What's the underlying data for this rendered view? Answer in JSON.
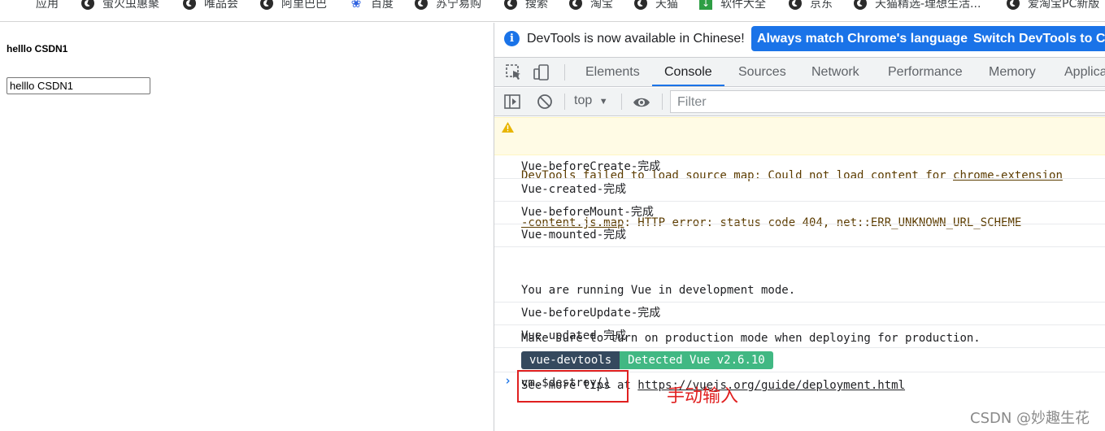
{
  "bookmarks": [
    {
      "label": "应用",
      "icon": "apps-icon"
    },
    {
      "label": "萤火虫惠聚",
      "icon": "globe-icon"
    },
    {
      "label": "唯品会",
      "icon": "globe-icon"
    },
    {
      "label": "阿里巴巴",
      "icon": "globe-icon"
    },
    {
      "label": "百度",
      "icon": "baidu-paw-icon"
    },
    {
      "label": "苏宁易购",
      "icon": "globe-icon"
    },
    {
      "label": "搜索",
      "icon": "globe-icon"
    },
    {
      "label": "淘宝",
      "icon": "globe-icon"
    },
    {
      "label": "天猫",
      "icon": "globe-icon"
    },
    {
      "label": "软件大全",
      "icon": "download-icon"
    },
    {
      "label": "京东",
      "icon": "globe-icon"
    },
    {
      "label": "天猫精选-理想生活...",
      "icon": "globe-icon"
    },
    {
      "label": "爱淘宝PC新版",
      "icon": "globe-icon"
    }
  ],
  "page": {
    "heading": "helllo CSDN1",
    "input_value": "helllo CSDN1"
  },
  "devtools": {
    "infobar": {
      "text": "DevTools is now available in Chinese!",
      "button1": "Always match Chrome's language",
      "button2": "Switch DevTools to Chinese"
    },
    "tabs": [
      "Elements",
      "Console",
      "Sources",
      "Network",
      "Performance",
      "Memory",
      "Application"
    ],
    "active_tab": "Console",
    "toolbar": {
      "context": "top",
      "filter_placeholder": "Filter"
    },
    "console": {
      "warning": {
        "line1_prefix": "DevTools failed to load source map: Could not load content for ",
        "line1_link": "chrome-extension",
        "line2_link": "-content.js.map",
        "line2_suffix": ": HTTP error: status code 404, net::ERR_UNKNOWN_URL_SCHEME"
      },
      "logs": [
        "Vue-beforeCreate-完成",
        "Vue-created-完成",
        "Vue-beforeMount-完成",
        "Vue-mounted-完成"
      ],
      "dev_mode": {
        "line1": "You are running Vue in development mode.",
        "line2": "Make sure to turn on production mode when deploying for production.",
        "line3_prefix": "See more tips at ",
        "line3_link": "https://vuejs.org/guide/deployment.html"
      },
      "logs2": [
        "Vue-beforeUpdate-完成",
        "Vue-updated-完成"
      ],
      "badge_left": "vue-devtools",
      "badge_right": "Detected Vue v2.6.10",
      "input_command": "vm.$destroy",
      "input_parens": "()"
    }
  },
  "annotation": "手动输入",
  "watermark": "CSDN @妙趣生花",
  "colors": {
    "accent": "#1a73e8",
    "warning_bg": "#fffbe5",
    "annotation_red": "#e02020",
    "badge_dark": "#35495e",
    "badge_green": "#41b883"
  }
}
